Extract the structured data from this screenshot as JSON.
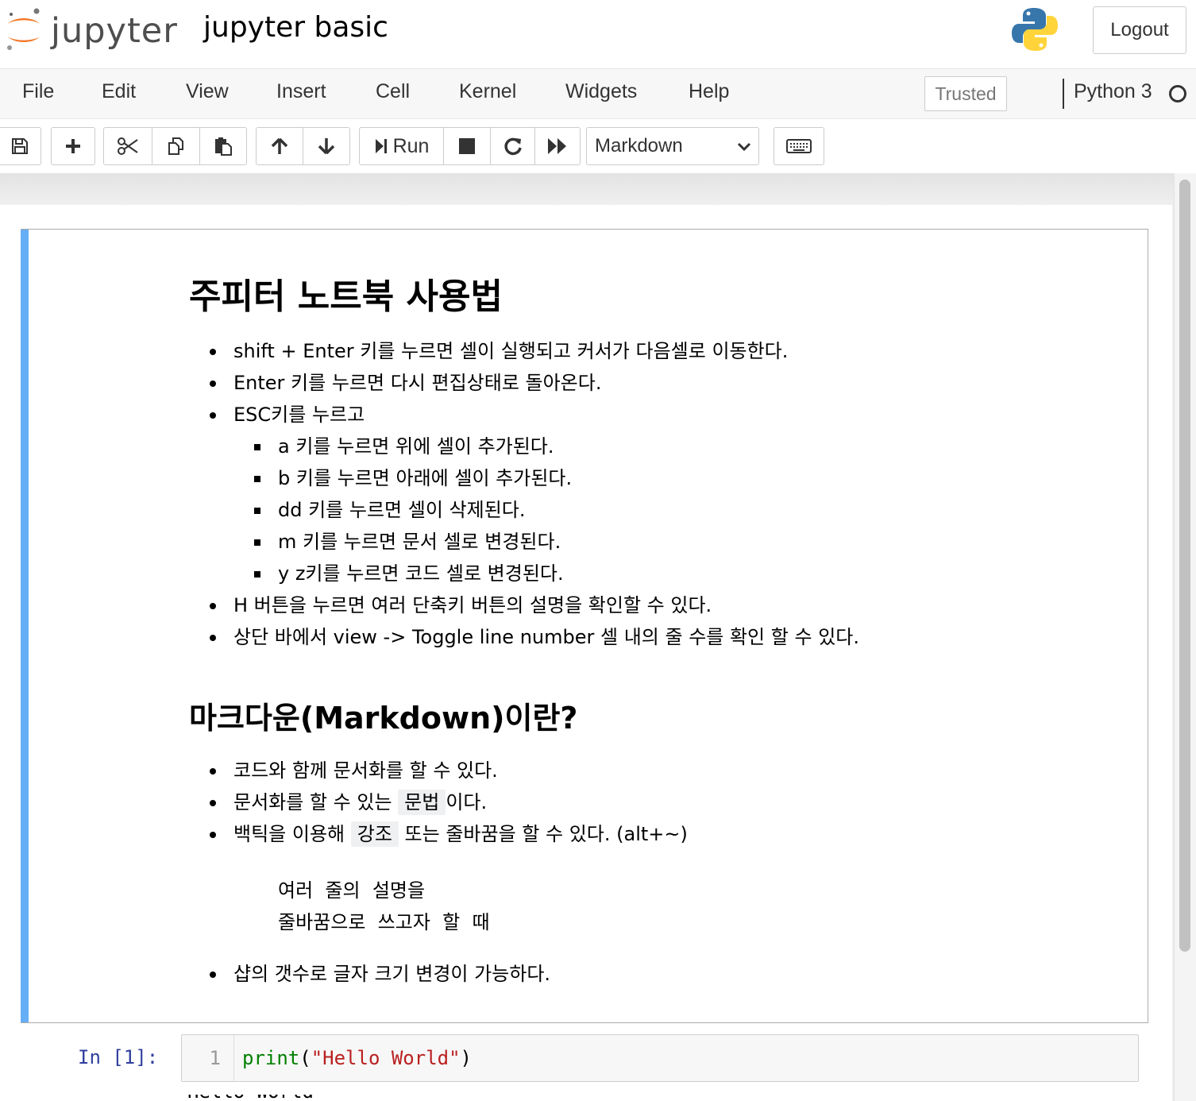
{
  "header": {
    "logo_text": "jupyter",
    "notebook_title": "jupyter basic",
    "logout_label": "Logout",
    "kernel_logo": "python-logo-icon"
  },
  "menubar": {
    "items": [
      "File",
      "Edit",
      "View",
      "Insert",
      "Cell",
      "Kernel",
      "Widgets",
      "Help"
    ],
    "trusted_label": "Trusted",
    "kernel_name": "Python 3",
    "kernel_status": "idle"
  },
  "toolbar": {
    "buttons": [
      "save-icon",
      "plus-icon",
      "cut-icon",
      "copy-icon",
      "paste-icon",
      "arrow-up-icon",
      "arrow-down-icon",
      "run-icon",
      "stop-icon",
      "restart-icon",
      "fast-forward-icon",
      "keyboard-icon"
    ],
    "run_label": "Run",
    "cell_type": "Markdown"
  },
  "markdown_cell": {
    "heading1": "주피터 노트북 사용법",
    "list1": [
      "shift + Enter 키를 누르면 셀이 실행되고 커서가 다음셀로 이동한다.",
      "Enter 키를 누르면 다시 편집상태로 돌아온다.",
      "ESC키를 누르고"
    ],
    "sublist": [
      "a 키를 누르면 위에 셀이 추가된다.",
      "b 키를 누르면 아래에 셀이 추가된다.",
      "dd 키를 누르면 셀이 삭제된다.",
      "m 키를 누르면 문서 셀로 변경된다.",
      "y z키를 누르면 코드 셀로 변경된다."
    ],
    "list1_tail": [
      "H 버튼을 누르면 여러 단축키 버튼의 설명을 확인할 수 있다.",
      "상단 바에서 view -> Toggle line number 셀 내의 줄 수를 확인 할 수 있다."
    ],
    "heading2": "마크다운(Markdown)이란?",
    "list2_item1": "코드와 함께 문서화를 할 수 있다.",
    "list2_item2_pre": "문서화를 할 수 있는 ",
    "list2_item2_code": "문법",
    "list2_item2_post": "이다.",
    "list2_item3_pre": "백틱을 이용해 ",
    "list2_item3_code": "강조",
    "list2_item3_post": " 또는 줄바꿈을 할 수 있다. (alt+~)",
    "code_block": [
      "여러  줄의  설명을",
      "줄바꿈으로  쓰고자  할  때"
    ],
    "list2_item4": "샵의 갯수로 글자 크기 변경이 가능하다."
  },
  "code_cell": {
    "prompt": "In [1]:",
    "line_number": "1",
    "code_func": "print",
    "code_open": "(",
    "code_string": "\"Hello World\"",
    "code_close": ")",
    "output_partial": "Hello World"
  }
}
